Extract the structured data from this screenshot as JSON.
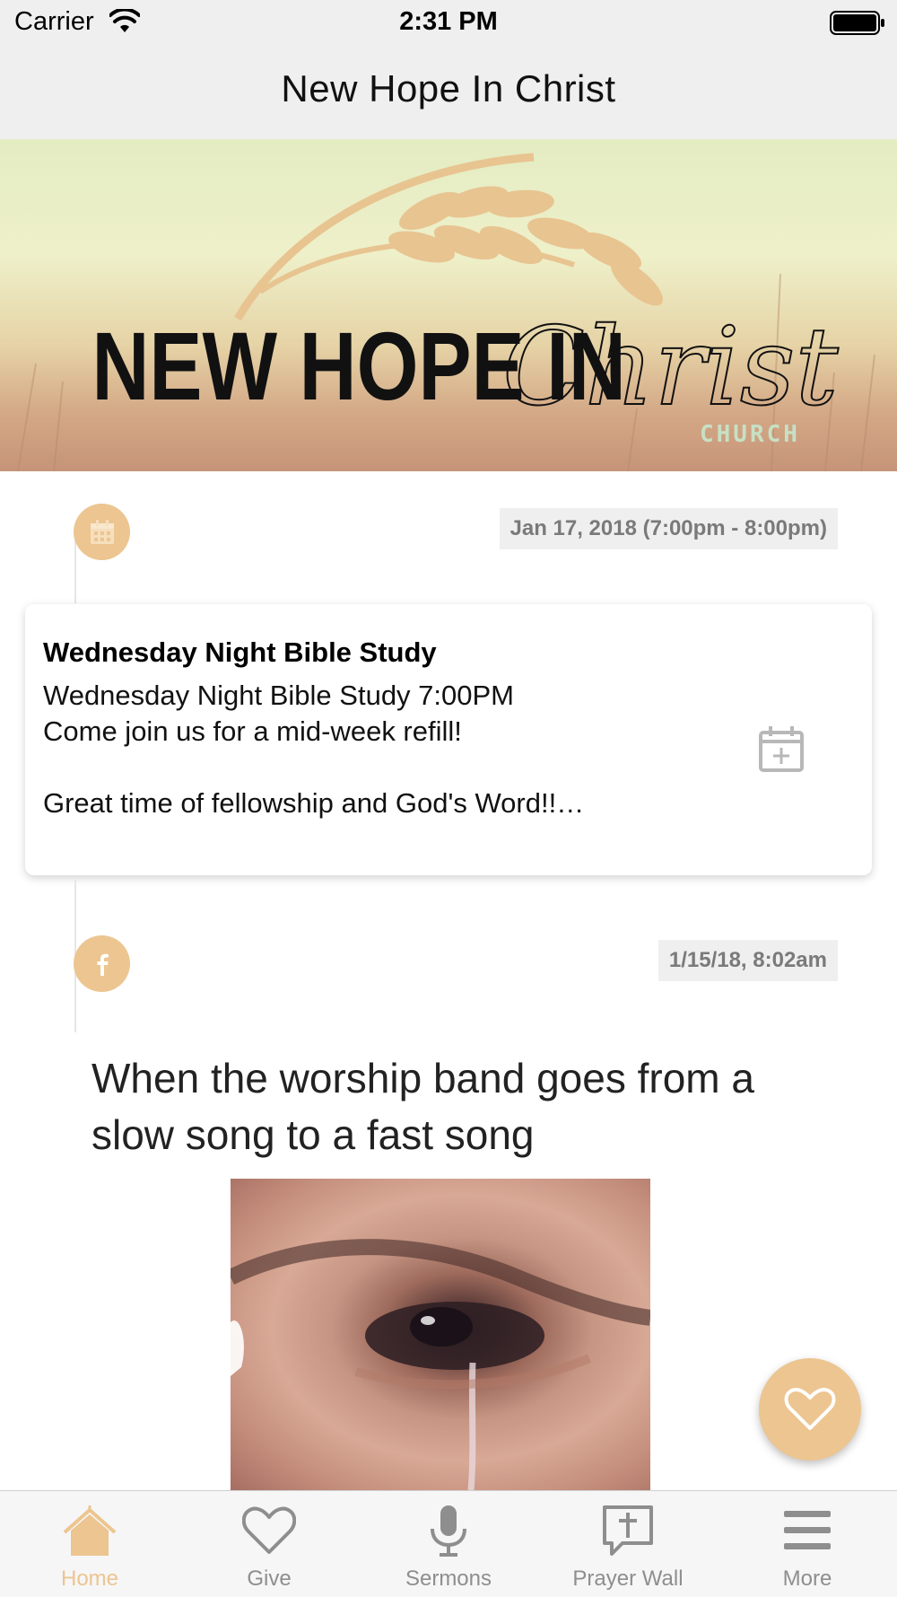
{
  "status_bar": {
    "carrier": "Carrier",
    "time": "2:31 PM"
  },
  "nav": {
    "title": "New Hope In Christ"
  },
  "banner": {
    "logo_text": "NEW HOPE IN",
    "logo_script": "Christ",
    "logo_sub": "CHURCH"
  },
  "feed": {
    "event": {
      "date": "Jan 17, 2018 (7:00pm - 8:00pm)",
      "title": "Wednesday Night Bible Study",
      "body": "Wednesday Night Bible Study 7:00PM\nCome join us for a mid-week refill!\n\nGreat time of fellowship and God's Word!!…",
      "icon": "calendar-icon",
      "action_icon": "add-to-calendar-icon"
    },
    "post": {
      "date": "1/15/18, 8:02am",
      "source_icon": "facebook-icon",
      "caption": "When the worship band goes from a slow song to a fast song"
    }
  },
  "fab": {
    "icon": "heart-icon"
  },
  "tabs": [
    {
      "label": "Home",
      "icon": "home-icon",
      "active": true
    },
    {
      "label": "Give",
      "icon": "heart-icon",
      "active": false
    },
    {
      "label": "Sermons",
      "icon": "microphone-icon",
      "active": false
    },
    {
      "label": "Prayer Wall",
      "icon": "prayer-wall-icon",
      "active": false
    },
    {
      "label": "More",
      "icon": "menu-icon",
      "active": false
    }
  ],
  "colors": {
    "accent": "#ecc590",
    "inactive": "#8e8e8e",
    "bar_bg": "#efefef"
  }
}
